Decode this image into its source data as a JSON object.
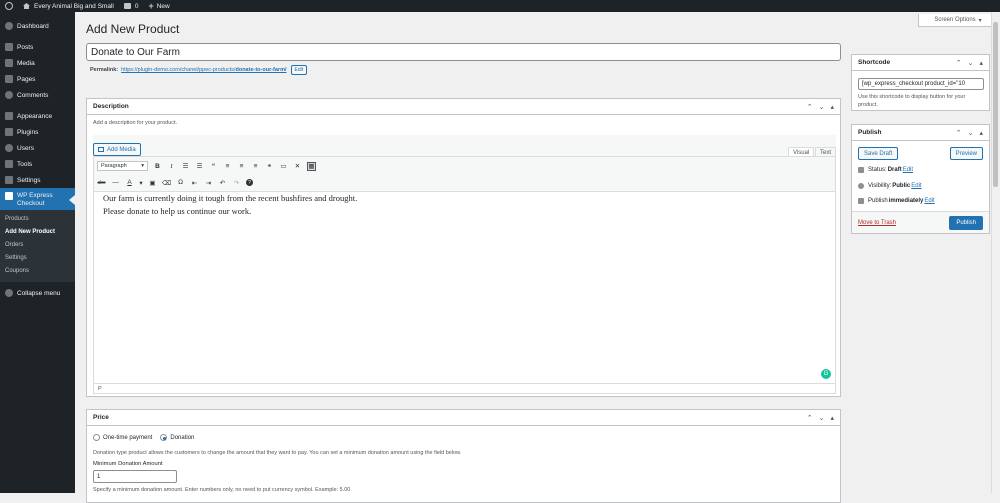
{
  "adminbar": {
    "site_name": "Every Animal Big and Small",
    "comments_count": "0",
    "new_label": "New"
  },
  "sidebar": {
    "items": [
      {
        "label": "Dashboard"
      },
      {
        "label": "Posts"
      },
      {
        "label": "Media"
      },
      {
        "label": "Pages"
      },
      {
        "label": "Comments"
      },
      {
        "label": "Appearance"
      },
      {
        "label": "Plugins"
      },
      {
        "label": "Users"
      },
      {
        "label": "Tools"
      },
      {
        "label": "Settings"
      },
      {
        "label": "WP Express Checkout"
      }
    ],
    "submenu": [
      "Products",
      "Add New Product",
      "Orders",
      "Settings",
      "Coupons"
    ],
    "collapse": "Collapse menu"
  },
  "screen_options": "Screen Options",
  "page_title": "Add New Product",
  "title_value": "Donate to Our Farm",
  "permalink": {
    "label": "Permalink:",
    "url_base": "https://plugin-demo.com/chanel/ppec-products/",
    "slug": "donate-to-our-farm/",
    "edit": "Edit"
  },
  "description": {
    "heading": "Description",
    "hint": "Add a description for your product.",
    "add_media": "Add Media",
    "tab_visual": "Visual",
    "tab_text": "Text",
    "format": "Paragraph",
    "paragraphs": [
      "Our farm is currently doing it tough from the recent bushfires and drought.",
      "Please donate to help us continue our work."
    ],
    "path": "P"
  },
  "price": {
    "heading": "Price",
    "opt_one_time": "One-time payment",
    "opt_donation": "Donation",
    "help": "Donation type product allows the customers to change the amount that they want to pay. You can set a minimum donation amount using the field below.",
    "min_label": "Minimum Donation Amount",
    "min_value": "1",
    "min_help": "Specify a minimum donation amount. Enter numbers only, no need to put currency symbol. Example: 5.00"
  },
  "shortcode": {
    "heading": "Shortcode",
    "value": "[wp_express_checkout product_id=\"10",
    "hint": "Use this shortcode to display button for your product."
  },
  "publish": {
    "heading": "Publish",
    "save_draft": "Save Draft",
    "preview": "Preview",
    "status_label": "Status:",
    "status_value": "Draft",
    "visibility_label": "Visibility:",
    "visibility_value": "Public",
    "schedule_label": "Publish",
    "schedule_value": "immediately",
    "edit": "Edit",
    "trash": "Move to Trash",
    "publish_btn": "Publish"
  }
}
